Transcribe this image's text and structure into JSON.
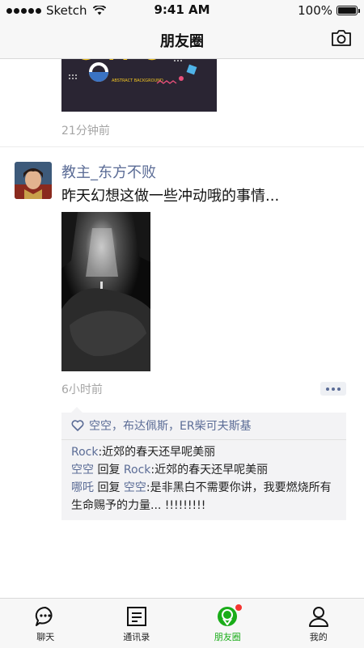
{
  "status_bar": {
    "carrier": "Sketch",
    "time": "9:41 AM",
    "battery": "100%"
  },
  "nav": {
    "title": "朋友圈"
  },
  "post1": {
    "time": "21分钟前",
    "image_text": "ABSTRACT BACKGROUND"
  },
  "post2": {
    "author": "教主_东方不败",
    "text": "昨天幻想这做一些冲动哦的事情...",
    "time": "6小时前",
    "likes": [
      "空空",
      "布达佩斯",
      "ER柴可夫斯基"
    ],
    "likes_separator": "，",
    "comments": [
      {
        "name": "Rock",
        "text": ":近郊的春天还早呢美丽"
      },
      {
        "name": "空空",
        "reply_word": "回复",
        "reply_to": "Rock",
        "text": ":近郊的春天还早呢美丽"
      },
      {
        "name": "哪吒",
        "reply_word": "回复",
        "reply_to": "空空",
        "text": ":是非黑白不需要你讲，我要燃烧所有生命赐予的力量... !!!!!!!!!"
      }
    ]
  },
  "tabs": [
    {
      "label": "聊天",
      "icon": "chat-bubble-icon"
    },
    {
      "label": "通讯录",
      "icon": "contacts-list-icon"
    },
    {
      "label": "朋友圈",
      "icon": "moments-icon"
    },
    {
      "label": "我的",
      "icon": "profile-icon"
    }
  ],
  "colors": {
    "accent_green": "#1aad19",
    "link_blue": "#5b6c96",
    "badge_red": "#f43530"
  }
}
